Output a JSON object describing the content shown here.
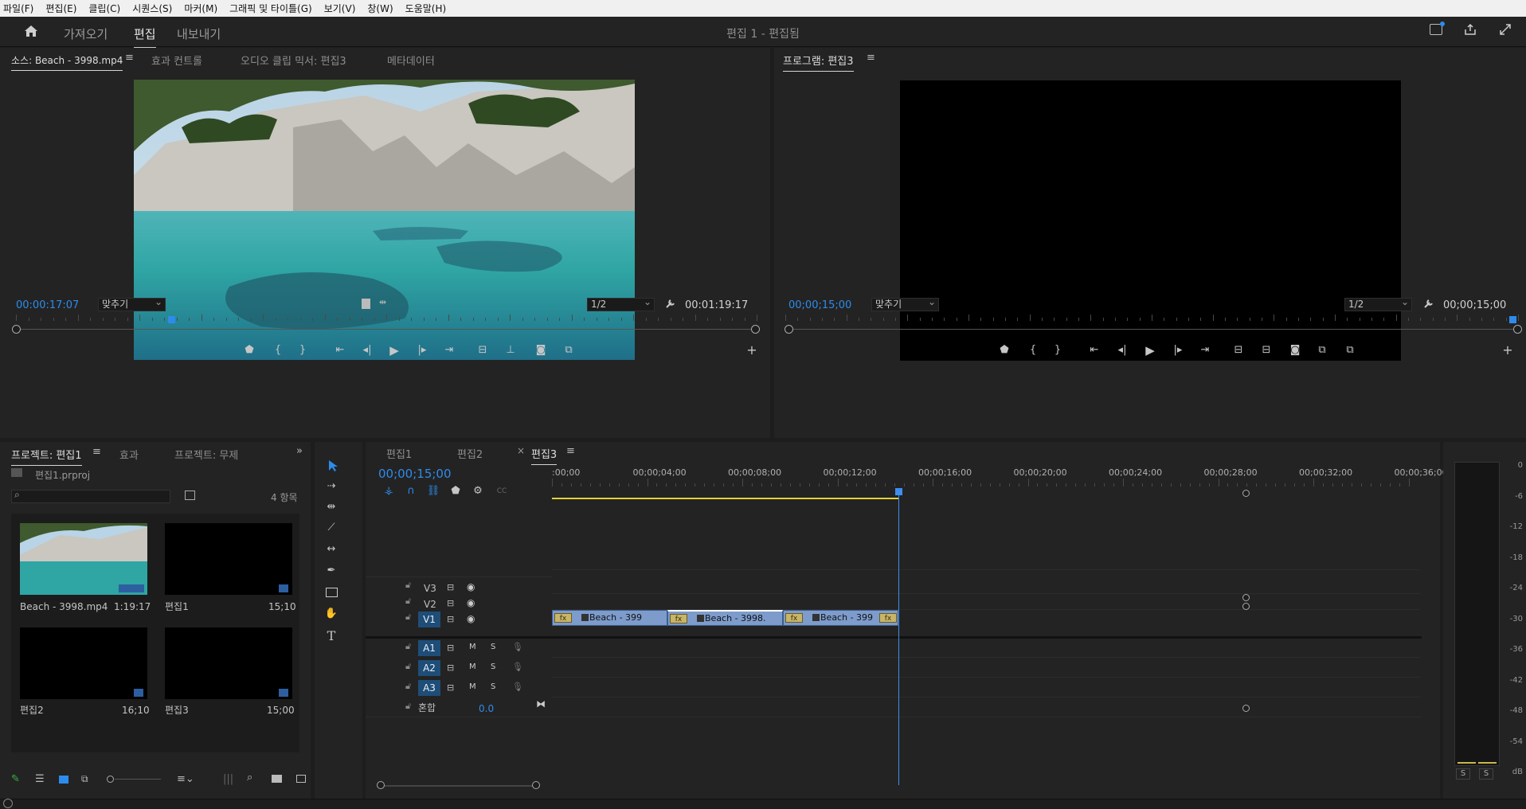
{
  "menu": [
    "파일(F)",
    "편집(E)",
    "클립(C)",
    "시퀀스(S)",
    "마커(M)",
    "그래픽 및 타이틀(G)",
    "보기(V)",
    "창(W)",
    "도움말(H)"
  ],
  "workspace": {
    "tabs": [
      "가져오기",
      "편집",
      "내보내기"
    ],
    "title": "편집 1 - 편집됨"
  },
  "source": {
    "tabs": [
      "소스: Beach - 3998.mp4",
      "효과 컨트롤",
      "오디오 클립 믹서: 편집3",
      "메타데이터"
    ],
    "timecode": "00:00:17:07",
    "fit": "맞추기",
    "res": "1/2",
    "duration": "00:01:19:17"
  },
  "program": {
    "tab": "프로그램: 편집3",
    "timecode": "00;00;15;00",
    "fit": "맞추기",
    "res": "1/2",
    "duration": "00;00;15;00"
  },
  "project": {
    "tabs": [
      "프로젝트: 편집1",
      "효과",
      "프로젝트: 무제"
    ],
    "file": "편집1.prproj",
    "count": "4 항목",
    "items": [
      {
        "name": "Beach - 3998.mp4",
        "dur": "1:19:17"
      },
      {
        "name": "편집1",
        "dur": "15;10"
      },
      {
        "name": "편집2",
        "dur": "16;10"
      },
      {
        "name": "편집3",
        "dur": "15;00"
      }
    ]
  },
  "timeline": {
    "tabs": [
      "편집1",
      "편집2",
      "편집3"
    ],
    "close": "×",
    "timecode": "00;00;15;00",
    "ruler": [
      ":00;00",
      "00;00;04;00",
      "00;00;08;00",
      "00;00;12;00",
      "00;00;16;00",
      "00;00;20;00",
      "00;00;24;00",
      "00;00;28;00",
      "00;00;32;00",
      "00;00;36;00"
    ],
    "video_tracks": [
      "V3",
      "V2",
      "V1"
    ],
    "audio_tracks": [
      "A1",
      "A2",
      "A3"
    ],
    "mix_label": "혼합",
    "mix_value": "0.0",
    "toggles": {
      "mute": "M",
      "solo": "S"
    },
    "clips": [
      "Beach - 399",
      "Beach - 3998.",
      "Beach - 399"
    ],
    "fx_badge": "fx"
  },
  "meter": {
    "labels": [
      "0",
      "-6",
      "-12",
      "-18",
      "-24",
      "-30",
      "-36",
      "-42",
      "-48",
      "-54",
      "dB"
    ],
    "solo": [
      "S",
      "S"
    ]
  },
  "colors": {
    "accent": "#2d8ceb",
    "playhead": "#3d8ff0",
    "clip": "#7d9ccc"
  }
}
